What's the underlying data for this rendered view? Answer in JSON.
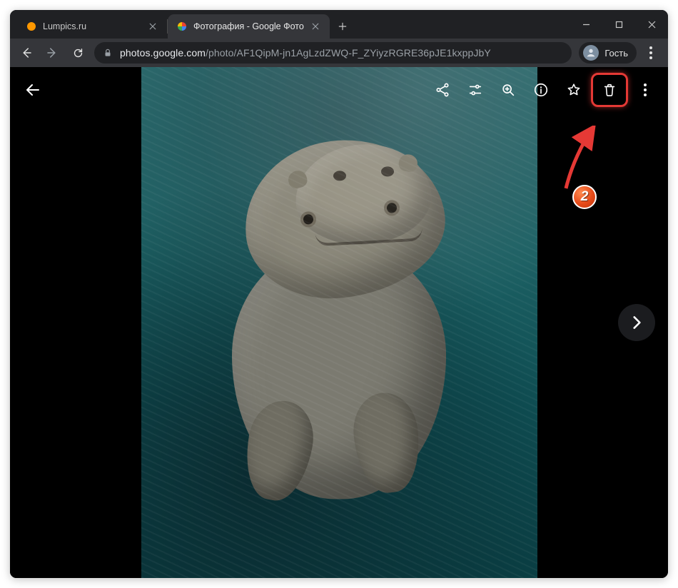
{
  "window": {
    "tabs": [
      {
        "title": "Lumpics.ru",
        "active": false,
        "favicon": "orange-dot"
      },
      {
        "title": "Фотография - Google Фото",
        "active": true,
        "favicon": "google-photos"
      }
    ]
  },
  "address_bar": {
    "host": "photos.google.com",
    "path": "/photo/AF1QipM-jn1AgLzdZWQ-F_ZYiyzRGRE36pJE1kxppJbY"
  },
  "profile": {
    "label": "Гость"
  },
  "photo_viewer": {
    "actions": {
      "share": "share-icon",
      "tune": "tune-icon",
      "zoom": "zoom-in-icon",
      "info": "info-icon",
      "favorite": "star-outline-icon",
      "delete": "trash-icon",
      "more": "more-vert-icon"
    }
  },
  "annotation": {
    "step_number": "2"
  }
}
